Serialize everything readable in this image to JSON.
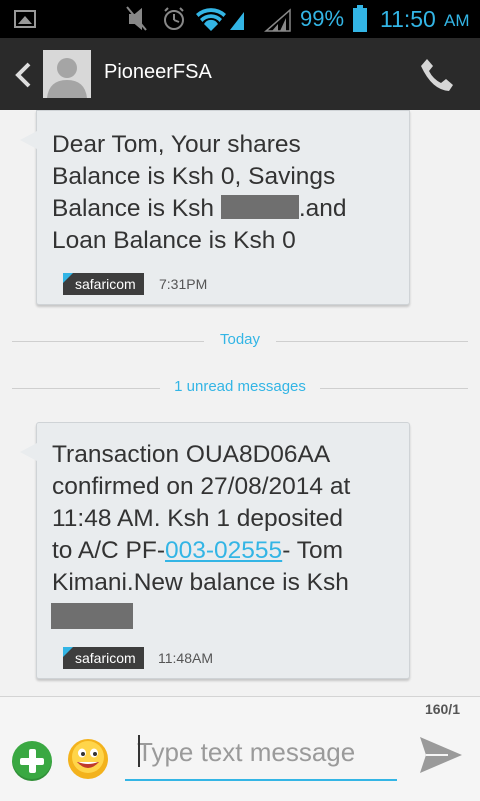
{
  "status_bar": {
    "battery_percent": "99%",
    "time": "11:50",
    "ampm": "AM",
    "icons": [
      "image-notification-icon",
      "mute-icon",
      "alarm-icon",
      "wifi-icon",
      "signal-icon",
      "signal-icon",
      "battery-icon"
    ]
  },
  "header": {
    "contact_name": "PioneerFSA",
    "icons": [
      "back-icon",
      "avatar",
      "phone-icon"
    ]
  },
  "messages": [
    {
      "line1": "Dear Tom, Your shares",
      "line2": "Balance is Ksh 0, Savings",
      "line3_before": "Balance is Ksh ",
      "line3_after": ".and",
      "line4": "Loan Balance is Ksh 0",
      "carrier": "safaricom",
      "time": "7:31PM"
    },
    {
      "line1": "Transaction OUA8D06AA",
      "line2": "confirmed on 27/08/2014 at",
      "line3": "11:48 AM. Ksh 1 deposited",
      "line4_before": "to A/C PF-",
      "line4_link": "003-02555",
      "line4_after": "- Tom",
      "line5": "Kimani.New balance is Ksh",
      "carrier": "safaricom",
      "time": "11:48AM"
    }
  ],
  "dividers": {
    "today": "Today",
    "unread": "1 unread messages"
  },
  "composer": {
    "counter": "160/1",
    "placeholder": "Type text message",
    "value": ""
  },
  "colors": {
    "accent": "#33b5e5",
    "action_bar": "#2a2a2a",
    "bubble": "#e9ecee",
    "add_button": "#3aa842"
  }
}
